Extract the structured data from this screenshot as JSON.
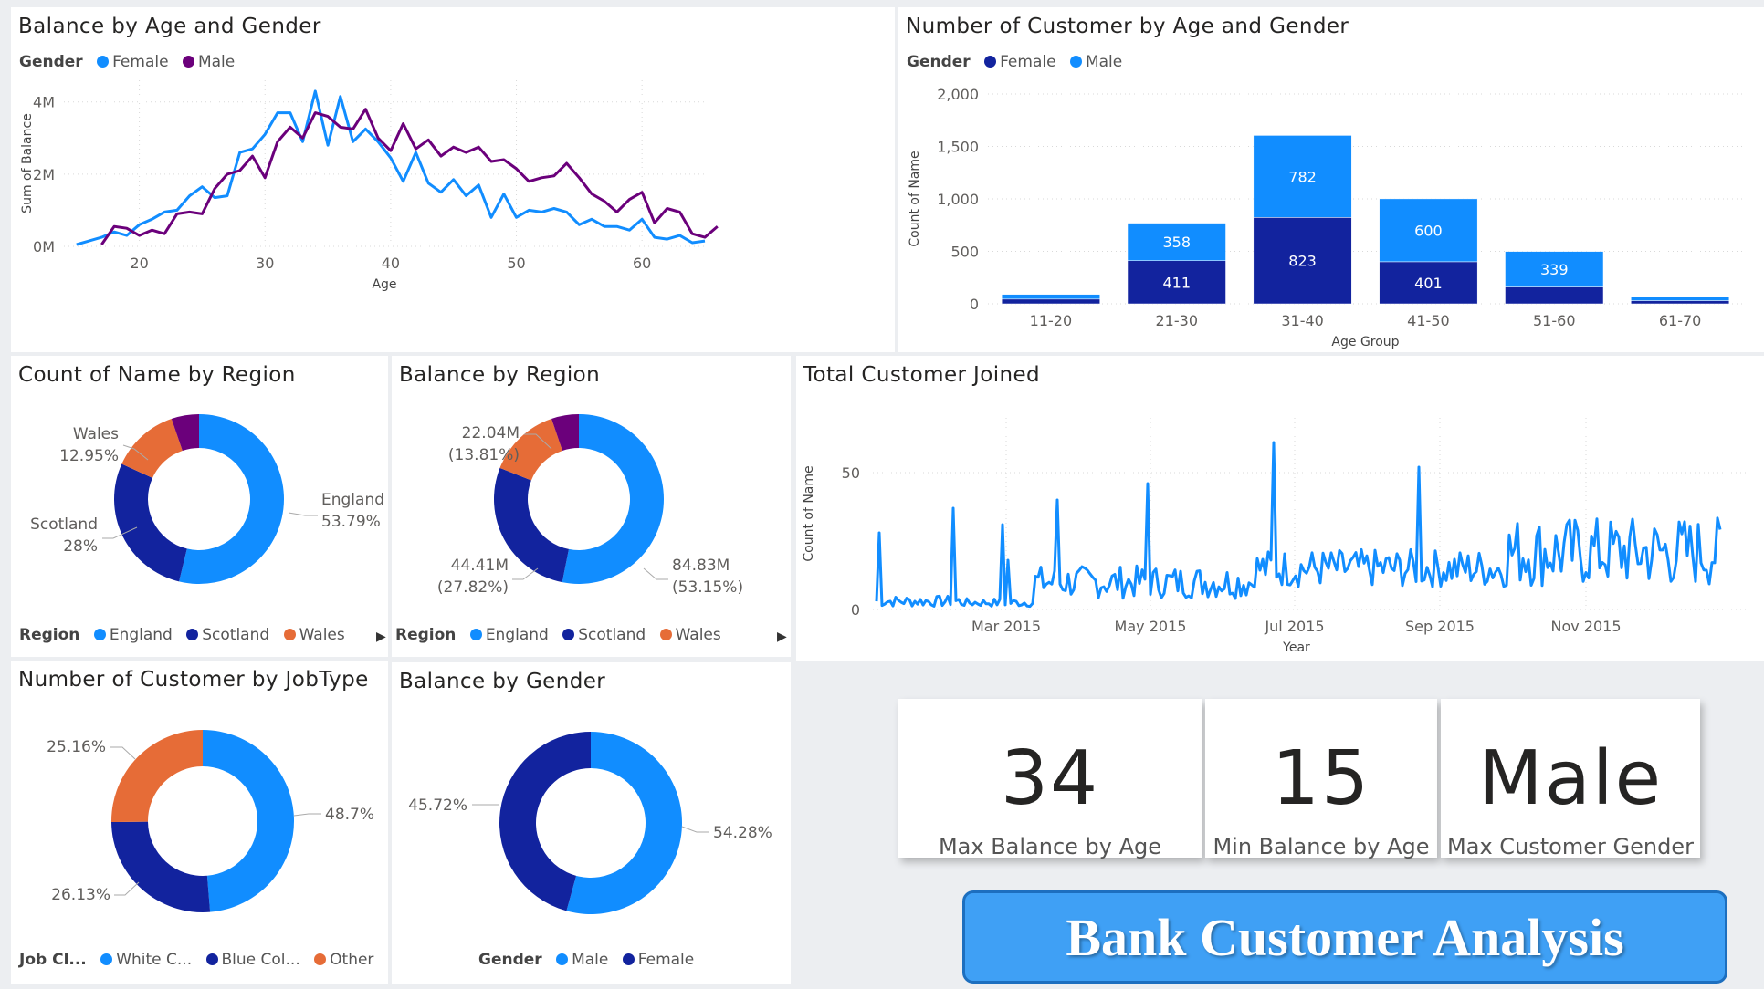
{
  "colors": {
    "light_blue": "#118dff",
    "dark_blue": "#12239e",
    "purple": "#6b007b",
    "orange": "#e66c37",
    "text": "#605e5c"
  },
  "title_banner": "Bank Customer Analysis",
  "kpis": [
    {
      "value": "34",
      "label": "Max Balance by Age"
    },
    {
      "value": "15",
      "label": "Min Balance by Age"
    },
    {
      "value": "Male",
      "label": "Max Customer Gender"
    }
  ],
  "chart_data": [
    {
      "id": "balance_age_gender",
      "type": "line",
      "title": "Balance by Age and Gender",
      "legend_label": "Gender",
      "xlabel": "Age",
      "ylabel": "Sum of Balance",
      "xlim": [
        14,
        65
      ],
      "ylim": [
        0,
        4600000
      ],
      "xticks": [
        20,
        30,
        40,
        50,
        60
      ],
      "yticks": [
        {
          "v": 0,
          "t": "0M"
        },
        {
          "v": 2000000,
          "t": "2M"
        },
        {
          "v": 4000000,
          "t": "4M"
        }
      ],
      "series": [
        {
          "name": "Female",
          "color": "#118dff",
          "points": [
            [
              15,
              50000
            ],
            [
              16,
              150000
            ],
            [
              17,
              250000
            ],
            [
              18,
              400000
            ],
            [
              19,
              300000
            ],
            [
              20,
              600000
            ],
            [
              21,
              750000
            ],
            [
              22,
              950000
            ],
            [
              23,
              1000000
            ],
            [
              24,
              1400000
            ],
            [
              25,
              1650000
            ],
            [
              26,
              1350000
            ],
            [
              27,
              1400000
            ],
            [
              28,
              2600000
            ],
            [
              29,
              2700000
            ],
            [
              30,
              3100000
            ],
            [
              31,
              3700000
            ],
            [
              32,
              3700000
            ],
            [
              33,
              2900000
            ],
            [
              34,
              4300000
            ],
            [
              35,
              2800000
            ],
            [
              36,
              4150000
            ],
            [
              37,
              2900000
            ],
            [
              38,
              3250000
            ],
            [
              39,
              2900000
            ],
            [
              40,
              2450000
            ],
            [
              41,
              1800000
            ],
            [
              42,
              2600000
            ],
            [
              43,
              1750000
            ],
            [
              44,
              1500000
            ],
            [
              45,
              1850000
            ],
            [
              46,
              1400000
            ],
            [
              47,
              1700000
            ],
            [
              48,
              800000
            ],
            [
              49,
              1450000
            ],
            [
              50,
              800000
            ],
            [
              51,
              1000000
            ],
            [
              52,
              950000
            ],
            [
              53,
              1050000
            ],
            [
              54,
              950000
            ],
            [
              55,
              600000
            ],
            [
              56,
              750000
            ],
            [
              57,
              550000
            ],
            [
              58,
              550000
            ],
            [
              59,
              450000
            ],
            [
              60,
              750000
            ],
            [
              61,
              250000
            ],
            [
              62,
              200000
            ],
            [
              63,
              300000
            ],
            [
              64,
              100000
            ],
            [
              65,
              150000
            ]
          ]
        },
        {
          "name": "Male",
          "color": "#6b007b",
          "points": [
            [
              17,
              50000
            ],
            [
              18,
              550000
            ],
            [
              19,
              500000
            ],
            [
              20,
              300000
            ],
            [
              21,
              450000
            ],
            [
              22,
              350000
            ],
            [
              23,
              900000
            ],
            [
              24,
              950000
            ],
            [
              25,
              900000
            ],
            [
              26,
              1600000
            ],
            [
              27,
              2000000
            ],
            [
              28,
              2100000
            ],
            [
              29,
              2500000
            ],
            [
              30,
              1900000
            ],
            [
              31,
              2900000
            ],
            [
              32,
              3300000
            ],
            [
              33,
              3000000
            ],
            [
              34,
              3700000
            ],
            [
              35,
              3600000
            ],
            [
              36,
              3300000
            ],
            [
              37,
              3250000
            ],
            [
              38,
              3800000
            ],
            [
              39,
              3000000
            ],
            [
              40,
              2650000
            ],
            [
              41,
              3400000
            ],
            [
              42,
              2700000
            ],
            [
              43,
              2950000
            ],
            [
              44,
              2500000
            ],
            [
              45,
              2750000
            ],
            [
              46,
              2600000
            ],
            [
              47,
              2750000
            ],
            [
              48,
              2350000
            ],
            [
              49,
              2400000
            ],
            [
              50,
              2150000
            ],
            [
              51,
              1800000
            ],
            [
              52,
              1900000
            ],
            [
              53,
              1950000
            ],
            [
              54,
              2300000
            ],
            [
              55,
              1900000
            ],
            [
              56,
              1450000
            ],
            [
              57,
              1250000
            ],
            [
              58,
              950000
            ],
            [
              59,
              1300000
            ],
            [
              60,
              1500000
            ],
            [
              61,
              650000
            ],
            [
              62,
              1050000
            ],
            [
              63,
              950000
            ],
            [
              64,
              350000
            ],
            [
              65,
              250000
            ],
            [
              66,
              550000
            ]
          ]
        }
      ]
    },
    {
      "id": "customer_age_group",
      "type": "bar",
      "title": "Number of Customer by Age and Gender",
      "legend_label": "Gender",
      "xlabel": "Age Group",
      "ylabel": "Count of Name",
      "ylim": [
        0,
        2000
      ],
      "yticks": [
        {
          "v": 0,
          "t": "0"
        },
        {
          "v": 500,
          "t": "500"
        },
        {
          "v": 1000,
          "t": "1,000"
        },
        {
          "v": 1500,
          "t": "1,500"
        },
        {
          "v": 2000,
          "t": "2,000"
        }
      ],
      "categories": [
        "11-20",
        "21-30",
        "31-40",
        "41-50",
        "51-60",
        "61-70"
      ],
      "series": [
        {
          "name": "Female",
          "color": "#12239e",
          "values": [
            45,
            411,
            823,
            401,
            160,
            30
          ],
          "labels": [
            "",
            "411",
            "823",
            "401",
            "",
            ""
          ]
        },
        {
          "name": "Male",
          "color": "#118dff",
          "values": [
            45,
            358,
            782,
            600,
            339,
            35
          ],
          "labels": [
            "",
            "358",
            "782",
            "600",
            "339",
            ""
          ]
        }
      ]
    },
    {
      "id": "count_region",
      "type": "pie",
      "title": "Count of Name by Region",
      "legend_label": "Region",
      "slices": [
        {
          "name": "England",
          "value": 53.79,
          "color": "#118dff"
        },
        {
          "name": "Scotland",
          "value": 28.0,
          "color": "#12239e"
        },
        {
          "name": "Wales",
          "value": 12.95,
          "color": "#e66c37"
        },
        {
          "name": "",
          "value": 5.26,
          "color": "#6b007b"
        }
      ],
      "annotations": {
        "l1": "England",
        "l2": "53.79%",
        "l3": "Scotland",
        "l4": "28%",
        "l5": "Wales",
        "l6": "12.95%"
      },
      "legend": [
        "England",
        "Scotland",
        "Wales"
      ]
    },
    {
      "id": "balance_region",
      "type": "pie",
      "title": "Balance by Region",
      "legend_label": "Region",
      "slices": [
        {
          "name": "England",
          "value": 53.15,
          "color": "#118dff"
        },
        {
          "name": "Scotland",
          "value": 27.82,
          "color": "#12239e"
        },
        {
          "name": "Wales",
          "value": 13.81,
          "color": "#e66c37"
        },
        {
          "name": "",
          "value": 5.22,
          "color": "#6b007b"
        }
      ],
      "annotations": {
        "l1": "84.83M",
        "l2": "(53.15%)",
        "l3": "44.41M",
        "l4": "(27.82%)",
        "l5": "22.04M",
        "l6": "(13.81%)"
      },
      "legend": [
        "England",
        "Scotland",
        "Wales"
      ]
    },
    {
      "id": "customer_joined",
      "type": "line",
      "title": "Total Customer Joined",
      "xlabel": "Year",
      "ylabel": "Count of Name",
      "ylim": [
        0,
        70
      ],
      "yticks": [
        {
          "v": 0,
          "t": "0"
        },
        {
          "v": 50,
          "t": "50"
        }
      ],
      "xticks": [
        "Mar 2015",
        "May 2015",
        "Jul 2015",
        "Sep 2015",
        "Nov 2015"
      ],
      "color": "#118dff"
    },
    {
      "id": "customer_jobtype",
      "type": "pie",
      "title": "Number of Customer by JobType",
      "legend_label": "Job Cl...",
      "slices": [
        {
          "name": "White C...",
          "value": 48.7,
          "color": "#118dff"
        },
        {
          "name": "Blue Col...",
          "value": 26.13,
          "color": "#12239e"
        },
        {
          "name": "Other",
          "value": 25.16,
          "color": "#e66c37"
        }
      ],
      "annotations": {
        "l1": "48.7%",
        "l2": "26.13%",
        "l3": "25.16%"
      },
      "legend": [
        "White C...",
        "Blue Col...",
        "Other"
      ]
    },
    {
      "id": "balance_gender",
      "type": "pie",
      "title": "Balance by Gender",
      "legend_label": "Gender",
      "slices": [
        {
          "name": "Male",
          "value": 54.28,
          "color": "#118dff"
        },
        {
          "name": "Female",
          "value": 45.72,
          "color": "#12239e"
        }
      ],
      "annotations": {
        "l1": "54.28%",
        "l2": "45.72%"
      },
      "legend": [
        "Male",
        "Female"
      ]
    }
  ]
}
